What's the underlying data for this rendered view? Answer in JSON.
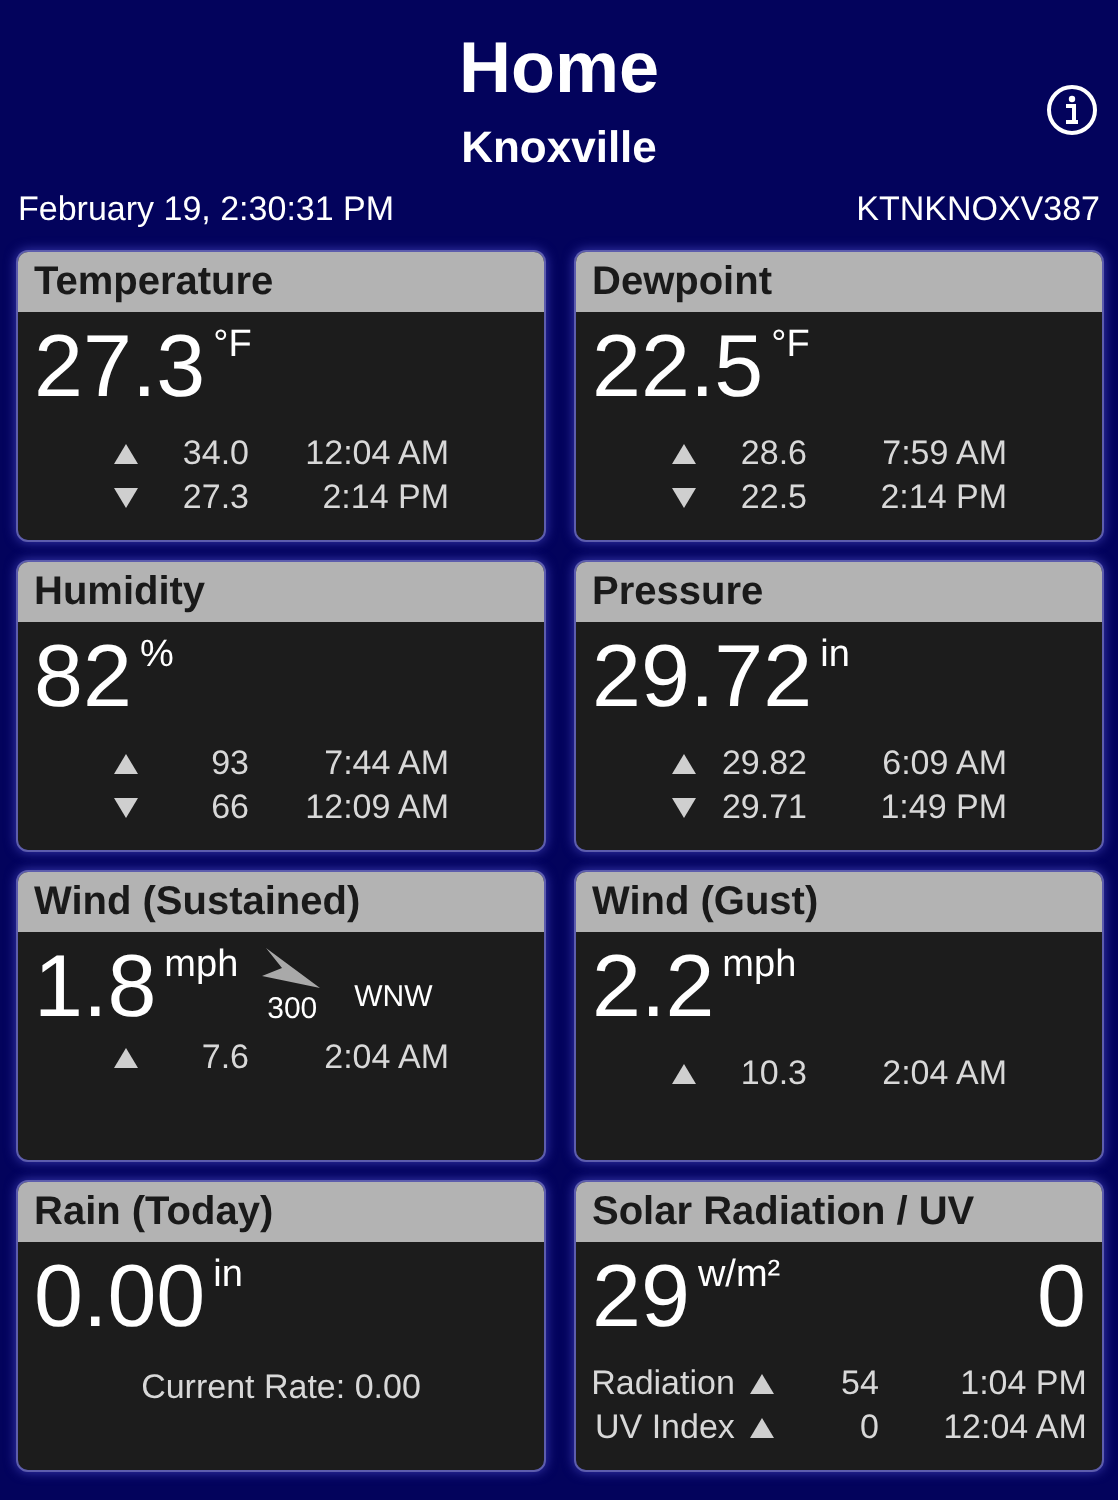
{
  "header": {
    "title": "Home",
    "subtitle": "Knoxville",
    "datetime": "February 19, 2:30:31 PM",
    "station": "KTNKNOXV387"
  },
  "cards": [
    {
      "kind": "stats",
      "title": "Temperature",
      "value": "27.3",
      "unit": "°F",
      "rows": [
        {
          "rising": true,
          "value": "34.0",
          "time": "12:04 AM"
        },
        {
          "rising": false,
          "value": "27.3",
          "time": "2:14 PM"
        }
      ]
    },
    {
      "kind": "stats",
      "title": "Dewpoint",
      "value": "22.5",
      "unit": "°F",
      "rows": [
        {
          "rising": true,
          "value": "28.6",
          "time": "7:59 AM"
        },
        {
          "rising": false,
          "value": "22.5",
          "time": "2:14 PM"
        }
      ]
    },
    {
      "kind": "stats",
      "title": "Humidity",
      "value": "82",
      "unit": "%",
      "rows": [
        {
          "rising": true,
          "value": "93",
          "time": "7:44 AM"
        },
        {
          "rising": false,
          "value": "66",
          "time": "12:09 AM"
        }
      ]
    },
    {
      "kind": "stats",
      "title": "Pressure",
      "value": "29.72",
      "unit": "in",
      "rows": [
        {
          "rising": true,
          "value": "29.82",
          "time": "6:09 AM"
        },
        {
          "rising": false,
          "value": "29.71",
          "time": "1:49 PM"
        }
      ]
    },
    {
      "kind": "wind",
      "title": "Wind (Sustained)",
      "value": "1.8",
      "unit": "mph",
      "bearing": "300",
      "compass": "WNW",
      "rows": [
        {
          "rising": true,
          "value": "7.6",
          "time": "2:04 AM"
        }
      ]
    },
    {
      "kind": "stats",
      "title": "Wind (Gust)",
      "value": "2.2",
      "unit": "mph",
      "rows": [
        {
          "rising": true,
          "value": "10.3",
          "time": "2:04 AM"
        }
      ]
    },
    {
      "kind": "rain",
      "title": "Rain (Today)",
      "value": "0.00",
      "unit": "in",
      "note": "Current Rate: 0.00"
    },
    {
      "kind": "solar",
      "title": "Solar Radiation / UV",
      "value": "29",
      "unit": "w/m²",
      "uv": "0",
      "rows": [
        {
          "label": "Radiation",
          "rising": true,
          "value": "54",
          "time": "1:04 PM"
        },
        {
          "label": "UV Index",
          "rising": true,
          "value": "0",
          "time": "12:04 AM"
        }
      ]
    }
  ]
}
